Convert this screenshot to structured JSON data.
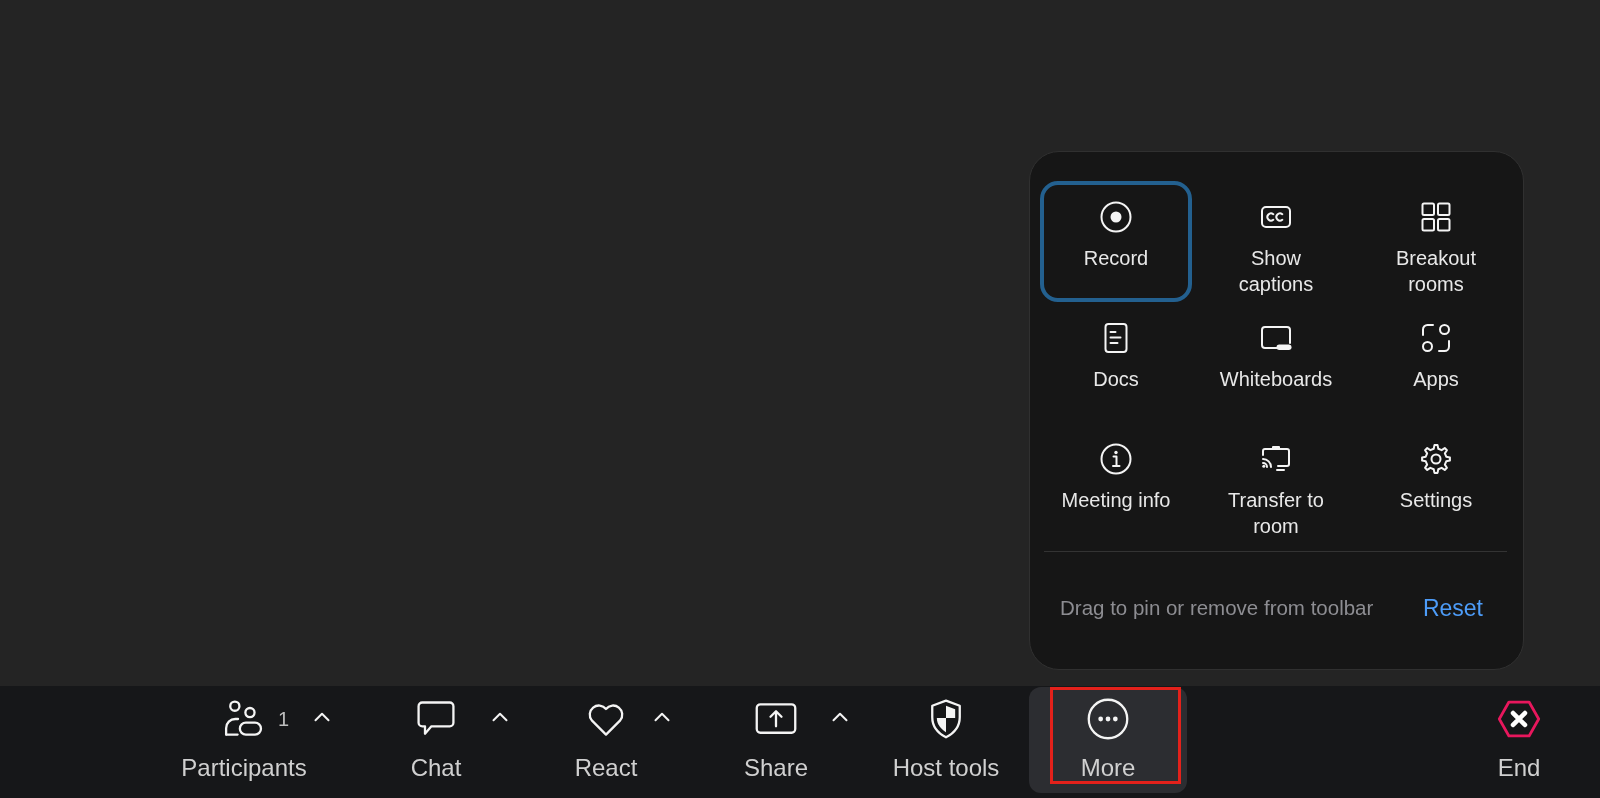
{
  "more_menu": {
    "items": [
      {
        "kind": "record",
        "label": "Record",
        "selected": true
      },
      {
        "kind": "captions",
        "label": "Show captions",
        "selected": false
      },
      {
        "kind": "breakout",
        "label": "Breakout rooms",
        "selected": false
      },
      {
        "kind": "docs",
        "label": "Docs",
        "selected": false
      },
      {
        "kind": "whiteboards",
        "label": "Whiteboards",
        "selected": false
      },
      {
        "kind": "apps",
        "label": "Apps",
        "selected": false
      },
      {
        "kind": "info",
        "label": "Meeting info",
        "selected": false
      },
      {
        "kind": "transfer",
        "label": "Transfer to room",
        "selected": false
      },
      {
        "kind": "settings",
        "label": "Settings",
        "selected": false
      }
    ],
    "hint": "Drag to pin or remove from toolbar",
    "reset": "Reset"
  },
  "toolbar": {
    "items": [
      {
        "kind": "participants",
        "label": "Participants",
        "count": "1",
        "menu": true,
        "active": false,
        "highlighted": false
      },
      {
        "kind": "chat",
        "label": "Chat",
        "menu": true,
        "active": false,
        "highlighted": false
      },
      {
        "kind": "react",
        "label": "React",
        "menu": true,
        "active": false,
        "highlighted": false
      },
      {
        "kind": "share",
        "label": "Share",
        "menu": true,
        "active": false,
        "highlighted": false
      },
      {
        "kind": "host",
        "label": "Host tools",
        "menu": false,
        "active": false,
        "highlighted": false
      },
      {
        "kind": "more",
        "label": "More",
        "menu": false,
        "active": true,
        "highlighted": true
      },
      {
        "kind": "end",
        "label": "End",
        "menu": false,
        "active": false,
        "highlighted": false
      }
    ]
  }
}
